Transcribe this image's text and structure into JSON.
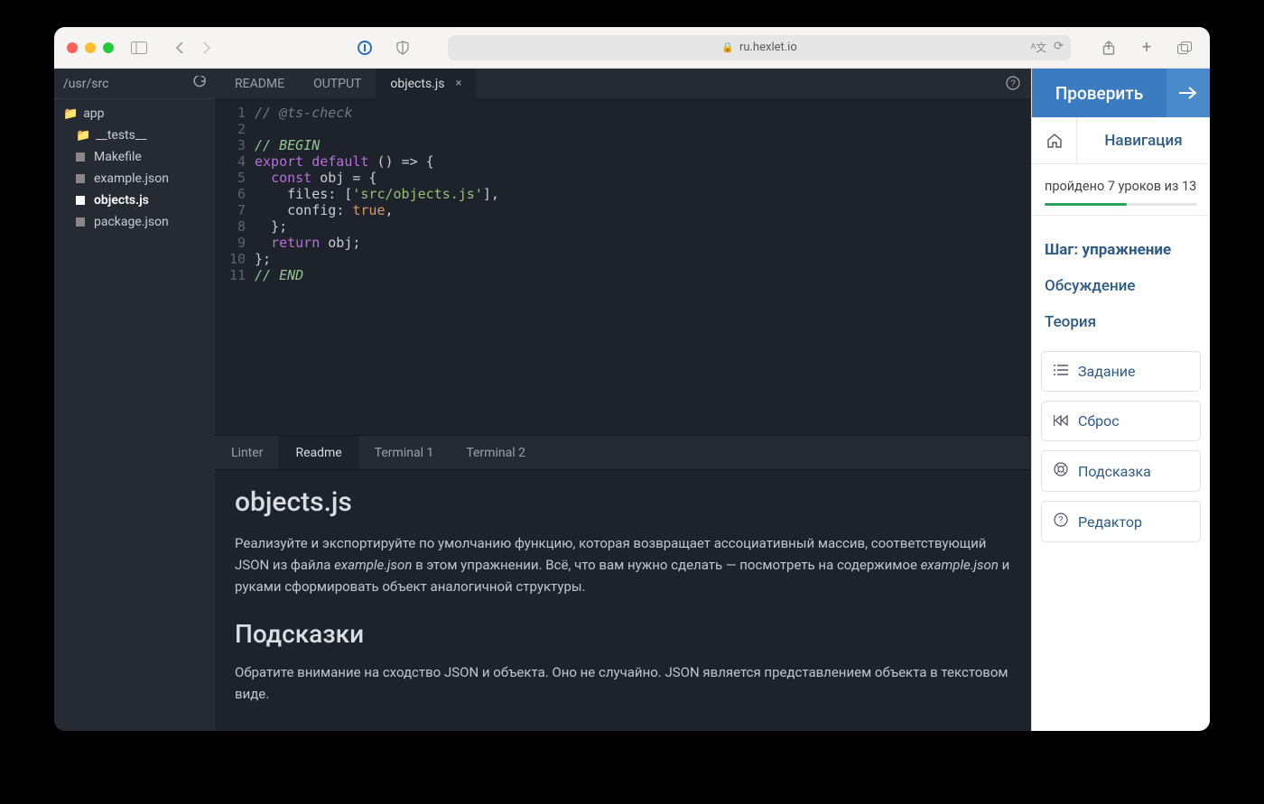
{
  "browser": {
    "url": "ru.hexlet.io"
  },
  "sidebar": {
    "path": "/usr/src",
    "tree": {
      "app": "app",
      "tests": "__tests__",
      "files": [
        "Makefile",
        "example.json",
        "objects.js",
        "package.json"
      ]
    }
  },
  "editor_tabs": [
    "README",
    "OUTPUT",
    "objects.js"
  ],
  "code_lines": [
    "// @ts-check",
    "",
    "// BEGIN",
    "export default () => {",
    "  const obj = {",
    "    files: ['src/objects.js'],",
    "    config: true,",
    "  };",
    "  return obj;",
    "};",
    "// END"
  ],
  "code_tokens": [
    [
      [
        "c-comment",
        "// @ts-check"
      ]
    ],
    [
      [
        "c-ident",
        ""
      ]
    ],
    [
      [
        "c-begin",
        "// BEGIN"
      ]
    ],
    [
      [
        "c-export",
        "export"
      ],
      [
        "c-ident",
        " "
      ],
      [
        "c-default",
        "default"
      ],
      [
        "c-punct",
        " () "
      ],
      [
        "c-punct",
        "=>"
      ],
      [
        "c-punct",
        " {"
      ]
    ],
    [
      [
        "c-ident",
        "  "
      ],
      [
        "c-const",
        "const"
      ],
      [
        "c-ident",
        " obj "
      ],
      [
        "c-punct",
        "="
      ],
      [
        "c-punct",
        " {"
      ]
    ],
    [
      [
        "c-ident",
        "    "
      ],
      [
        "c-prop",
        "files"
      ],
      [
        "c-punct",
        ": ["
      ],
      [
        "c-string",
        "'src/objects.js'"
      ],
      [
        "c-punct",
        "],"
      ]
    ],
    [
      [
        "c-ident",
        "    "
      ],
      [
        "c-prop",
        "config"
      ],
      [
        "c-punct",
        ": "
      ],
      [
        "c-bool",
        "true"
      ],
      [
        "c-punct",
        ","
      ]
    ],
    [
      [
        "c-punct",
        "  };"
      ]
    ],
    [
      [
        "c-ident",
        "  "
      ],
      [
        "c-return",
        "return"
      ],
      [
        "c-ident",
        " obj"
      ],
      [
        "c-punct",
        ";"
      ]
    ],
    [
      [
        "c-punct",
        "};"
      ]
    ],
    [
      [
        "c-begin",
        "// END"
      ]
    ]
  ],
  "bottom_tabs": [
    "Linter",
    "Readme",
    "Terminal 1",
    "Terminal 2"
  ],
  "readme": {
    "title": "objects.js",
    "body": "Реализуйте и экспортируйте по умолчанию функцию, которая возвращает ассоциативный массив, соответствующий JSON из файла ",
    "body2": " в этом упражнении. Всё, что вам нужно сделать — посмотреть на содержимое ",
    "body3": " и руками сформировать объект аналогичной структуры.",
    "example": "example.json",
    "hints_title": "Подсказки",
    "hint": "Обратите внимание на сходство JSON и объекта. Оно не случайно. JSON является представлением объекта в текстовом виде."
  },
  "right": {
    "check": "Проверить",
    "nav": "Навигация",
    "progress_text": "пройдено 7 уроков из 13",
    "links": [
      "Шаг: упражнение",
      "Обсуждение",
      "Теория"
    ],
    "actions": [
      "Задание",
      "Сброс",
      "Подсказка",
      "Редактор"
    ]
  }
}
